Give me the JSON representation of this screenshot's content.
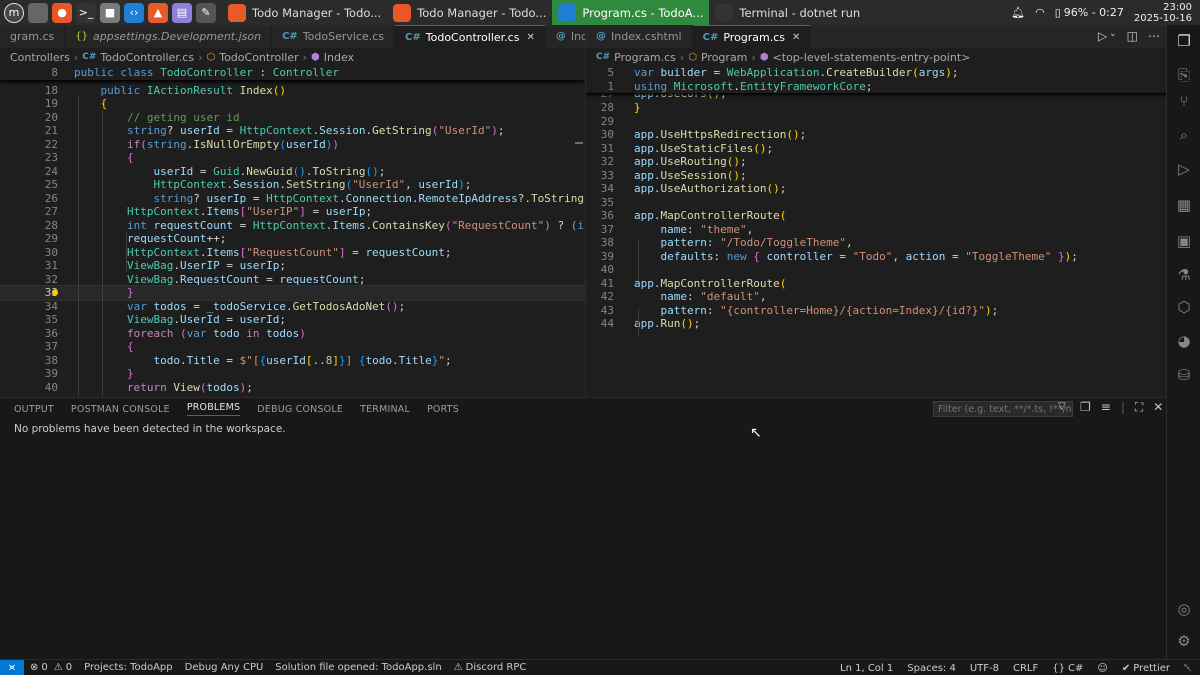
{
  "taskbar": {
    "launchers": [
      {
        "name": "mint-menu-icon",
        "glyph": "m",
        "color": "#444"
      },
      {
        "name": "show-desktop-icon",
        "glyph": "",
        "color": "#666"
      },
      {
        "name": "firefox-launcher-icon",
        "glyph": "●",
        "color": "#e8562a"
      },
      {
        "name": "terminal-launcher-icon",
        "glyph": ">_",
        "color": "#333"
      },
      {
        "name": "files-launcher-icon",
        "glyph": "■",
        "color": "#7a7a7a"
      },
      {
        "name": "vscode-launcher-icon",
        "glyph": "‹›",
        "color": "#1f7fd1"
      },
      {
        "name": "brave-launcher-icon",
        "glyph": "▲",
        "color": "#e55b2b"
      },
      {
        "name": "notes-launcher-icon",
        "glyph": "▤",
        "color": "#8e7fd9"
      },
      {
        "name": "text-editor-launcher-icon",
        "glyph": "✎",
        "color": "#555"
      }
    ],
    "tasks": [
      {
        "label": "Todo Manager - Todo...",
        "icon_color": "#e55b2b",
        "active": false
      },
      {
        "label": "Todo Manager - Todo...",
        "icon_color": "#e8562a",
        "active": false
      },
      {
        "label": "Program.cs - TodoA...",
        "icon_color": "#1f7fd1",
        "active": true
      },
      {
        "label": "Terminal - dotnet run",
        "icon_color": "#333333",
        "active": false
      }
    ],
    "battery": "96% - 0:27",
    "time": "23:00",
    "date": "2025-10-16"
  },
  "left_editor": {
    "tabs": [
      {
        "label": "gram.cs",
        "icon": "",
        "active": false,
        "italic": false
      },
      {
        "label": "appsettings.Development.json",
        "icon": "{}",
        "active": false,
        "italic": true
      },
      {
        "label": "TodoService.cs",
        "icon": "C#",
        "active": false,
        "italic": false
      },
      {
        "label": "TodoController.cs",
        "icon": "C#",
        "active": true,
        "italic": false
      },
      {
        "label": "Index.cshtml",
        "icon": "@",
        "active": false,
        "italic": false
      },
      {
        "label": "",
        "icon": "@",
        "active": false,
        "italic": false
      }
    ],
    "breadcrumb": [
      "Controllers",
      "TodoController.cs",
      "TodoController",
      "Index"
    ]
  },
  "right_editor": {
    "tabs": [
      {
        "label": "Index.cshtml",
        "icon": "@",
        "active": false
      },
      {
        "label": "Program.cs",
        "icon": "C#",
        "active": true
      }
    ],
    "breadcrumb": [
      "Program.cs",
      "Program",
      "<top-level-statements-entry-point>"
    ]
  },
  "panel": {
    "tabs": [
      "OUTPUT",
      "POSTMAN CONSOLE",
      "PROBLEMS",
      "DEBUG CONSOLE",
      "TERMINAL",
      "PORTS"
    ],
    "active_tab": "PROBLEMS",
    "filter_placeholder": "Filter (e.g. text, **/*.ts, !**/n...",
    "message": "No problems have been detected in the workspace."
  },
  "status": {
    "errors": "0",
    "warnings": "0",
    "project": "Projects: TodoApp",
    "config": "Debug Any CPU",
    "solution": "Solution file opened: TodoApp.sln",
    "discord": "Discord RPC",
    "position": "Ln 1, Col 1",
    "spaces": "Spaces: 4",
    "encoding": "UTF-8",
    "eol": "CRLF",
    "language": "C#",
    "prettier": "Prettier"
  }
}
